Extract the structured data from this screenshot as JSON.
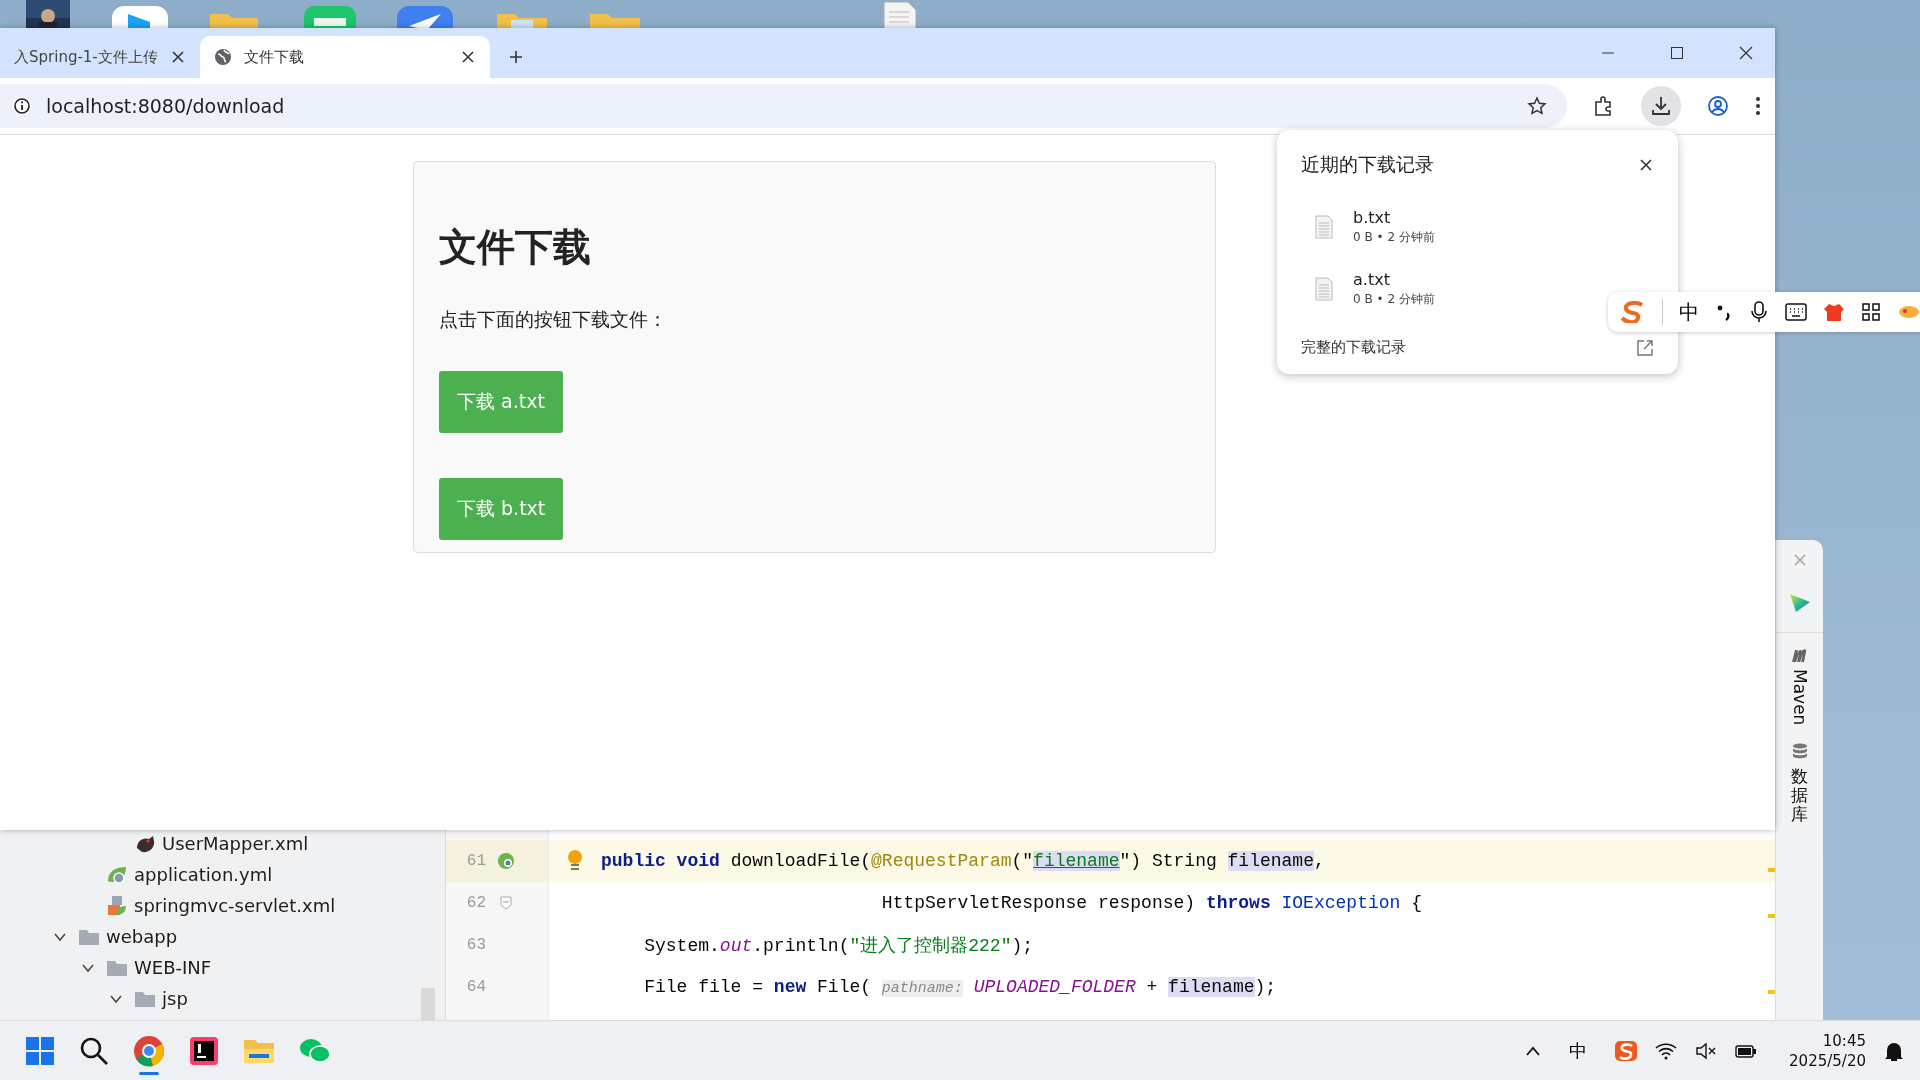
{
  "browser": {
    "tabs": [
      {
        "title": "入Spring-1-文件上传",
        "selected": false
      },
      {
        "title": "文件下载",
        "selected": true
      }
    ],
    "address": "localhost:8080/download",
    "page": {
      "heading": "文件下载",
      "prompt": "点击下面的按钮下载文件：",
      "buttons": [
        "下载 a.txt",
        "下载 b.txt"
      ]
    },
    "downloads_panel": {
      "title": "近期的下载记录",
      "items": [
        {
          "name": "b.txt",
          "meta": "0 B • 2 分钟前"
        },
        {
          "name": "a.txt",
          "meta": "0 B • 2 分钟前"
        }
      ],
      "footer": "完整的下载记录"
    }
  },
  "ime_toolbar": {
    "mode": "中"
  },
  "ide": {
    "project_tree": [
      {
        "children": [
          {
            "children": [
              {
                "children": [
                  {
                    "label": "UserMapper.xml",
                    "kind": "mapper"
                  }
                ]
              },
              {
                "label": "application.yml",
                "kind": "yml"
              },
              {
                "label": "springmvc-servlet.xml",
                "kind": "xml"
              }
            ]
          },
          {
            "label": "webapp",
            "kind": "folder",
            "expanded": true,
            "children": [
              {
                "label": "WEB-INF",
                "kind": "folder",
                "expanded": true,
                "children": [
                  {
                    "label": "jsp",
                    "kind": "folder",
                    "expanded": true
                  }
                ]
              }
            ]
          }
        ]
      }
    ],
    "code_lines": [
      {
        "number": "61",
        "current": true,
        "kind": "bean",
        "bulb": true,
        "tokens": [
          {
            "kind": "keyword",
            "text": "public"
          },
          {
            "kind": "keyword",
            "text": " void"
          },
          {
            "kind": "plain",
            "text": " downloadFile("
          },
          {
            "kind": "annotation",
            "text": "@RequestParam"
          },
          {
            "kind": "plain",
            "text": "(\""
          },
          {
            "kind": "string-ref",
            "text": "filename"
          },
          {
            "kind": "plain",
            "text": "\") String "
          },
          {
            "kind": "usage",
            "text": "filename"
          },
          {
            "kind": "plain",
            "text": ","
          }
        ]
      },
      {
        "number": "62",
        "current": false,
        "kind": "fold",
        "bulb": false,
        "tokens": [
          {
            "kind": "plain",
            "text": "                          HttpServletResponse response) "
          },
          {
            "kind": "keyword",
            "text": "throws"
          },
          {
            "kind": "type",
            "text": " IOException"
          },
          {
            "kind": "plain",
            "text": " {"
          }
        ]
      },
      {
        "number": "63",
        "current": false,
        "kind": "plain",
        "bulb": false,
        "tokens": [
          {
            "kind": "plain",
            "text": "    System."
          },
          {
            "kind": "field",
            "text": "out"
          },
          {
            "kind": "plain",
            "text": ".println("
          },
          {
            "kind": "string",
            "text": "\"进入了控制器222\""
          },
          {
            "kind": "plain",
            "text": ");"
          }
        ]
      },
      {
        "number": "64",
        "current": false,
        "kind": "plain",
        "bulb": false,
        "tokens": [
          {
            "kind": "plain",
            "text": "    File file = "
          },
          {
            "kind": "keyword",
            "text": "new"
          },
          {
            "kind": "plain",
            "text": " File( "
          },
          {
            "kind": "hint",
            "text": "pathname:"
          },
          {
            "kind": "field",
            "text": " UPLOADED_FOLDER"
          },
          {
            "kind": "plain",
            "text": " + "
          },
          {
            "kind": "usage",
            "text": "filename"
          },
          {
            "kind": "plain",
            "text": ");"
          }
        ]
      }
    ],
    "side_panel": {
      "tools": [
        {
          "kind": "maven",
          "label": "Maven"
        },
        {
          "kind": "database",
          "label": "数据库"
        }
      ]
    }
  },
  "taskbar": {
    "input_indicator": "中",
    "time": "10:45",
    "date": "2025/5/20"
  }
}
